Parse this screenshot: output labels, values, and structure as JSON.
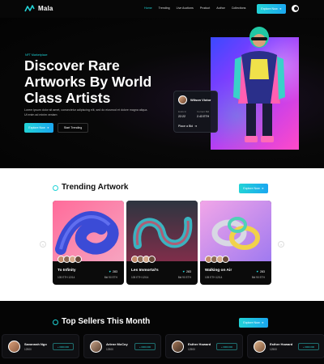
{
  "brand": {
    "name": "Mala"
  },
  "nav": {
    "items": [
      {
        "label": "Home",
        "active": true
      },
      {
        "label": "Trending",
        "active": false
      },
      {
        "label": "Live Auctions",
        "active": false
      },
      {
        "label": "Product",
        "active": false
      },
      {
        "label": "Author",
        "active": false
      },
      {
        "label": "Collections",
        "active": false
      }
    ],
    "explore_label": "Explore Now"
  },
  "hero": {
    "tag": "NFT Marketplace",
    "title": "Discover Rare Artworks By World Class Artists",
    "description": "Lorem ipsum dolor sit amet, consectetur adipiscing elit, sed do eiusmod et dolore magna aliqua. Ut enim ad minim veniam",
    "primary_button": "Explore Now",
    "secondary_button": "Start Trending",
    "bid_card": {
      "artist": "Wilson Victor",
      "left_label": "Ends In",
      "left_value": "22:22",
      "right_label": "Current Bid",
      "right_value": "2.43 ETH",
      "action": "Place a Bid"
    }
  },
  "trending": {
    "title": "Trending Artwork",
    "explore_label": "Explore Now",
    "cards": [
      {
        "name": "To Infinity",
        "price": "105 ETH 12/14",
        "likes": "283",
        "bid": "Bid 90 ETH"
      },
      {
        "name": "Les Immortal's",
        "price": "105 ETH 12/14",
        "likes": "283",
        "bid": "Bid 90 ETH"
      },
      {
        "name": "Walking on Air",
        "price": "105 ETH 12/14",
        "likes": "283",
        "bid": "Bid 90 ETH"
      }
    ]
  },
  "sellers": {
    "title": "Top Sellers This Month",
    "explore_label": "Explore Now",
    "items": [
      {
        "name": "Savannah Ngo",
        "value": "12500",
        "action": "+ 0000.000"
      },
      {
        "name": "Arlene McCoy",
        "value": "12500",
        "action": "+ 0000.000"
      },
      {
        "name": "Esther Howard",
        "value": "12500",
        "action": "+ 0000.000"
      },
      {
        "name": "Esther Howard",
        "value": "12500",
        "action": "+ 0000.000"
      }
    ]
  },
  "colors": {
    "accent": "#1ed3d6",
    "accent_gradient_end": "#1ba7f0",
    "hero_bg": "#050505",
    "section_light": "#ffffff"
  }
}
